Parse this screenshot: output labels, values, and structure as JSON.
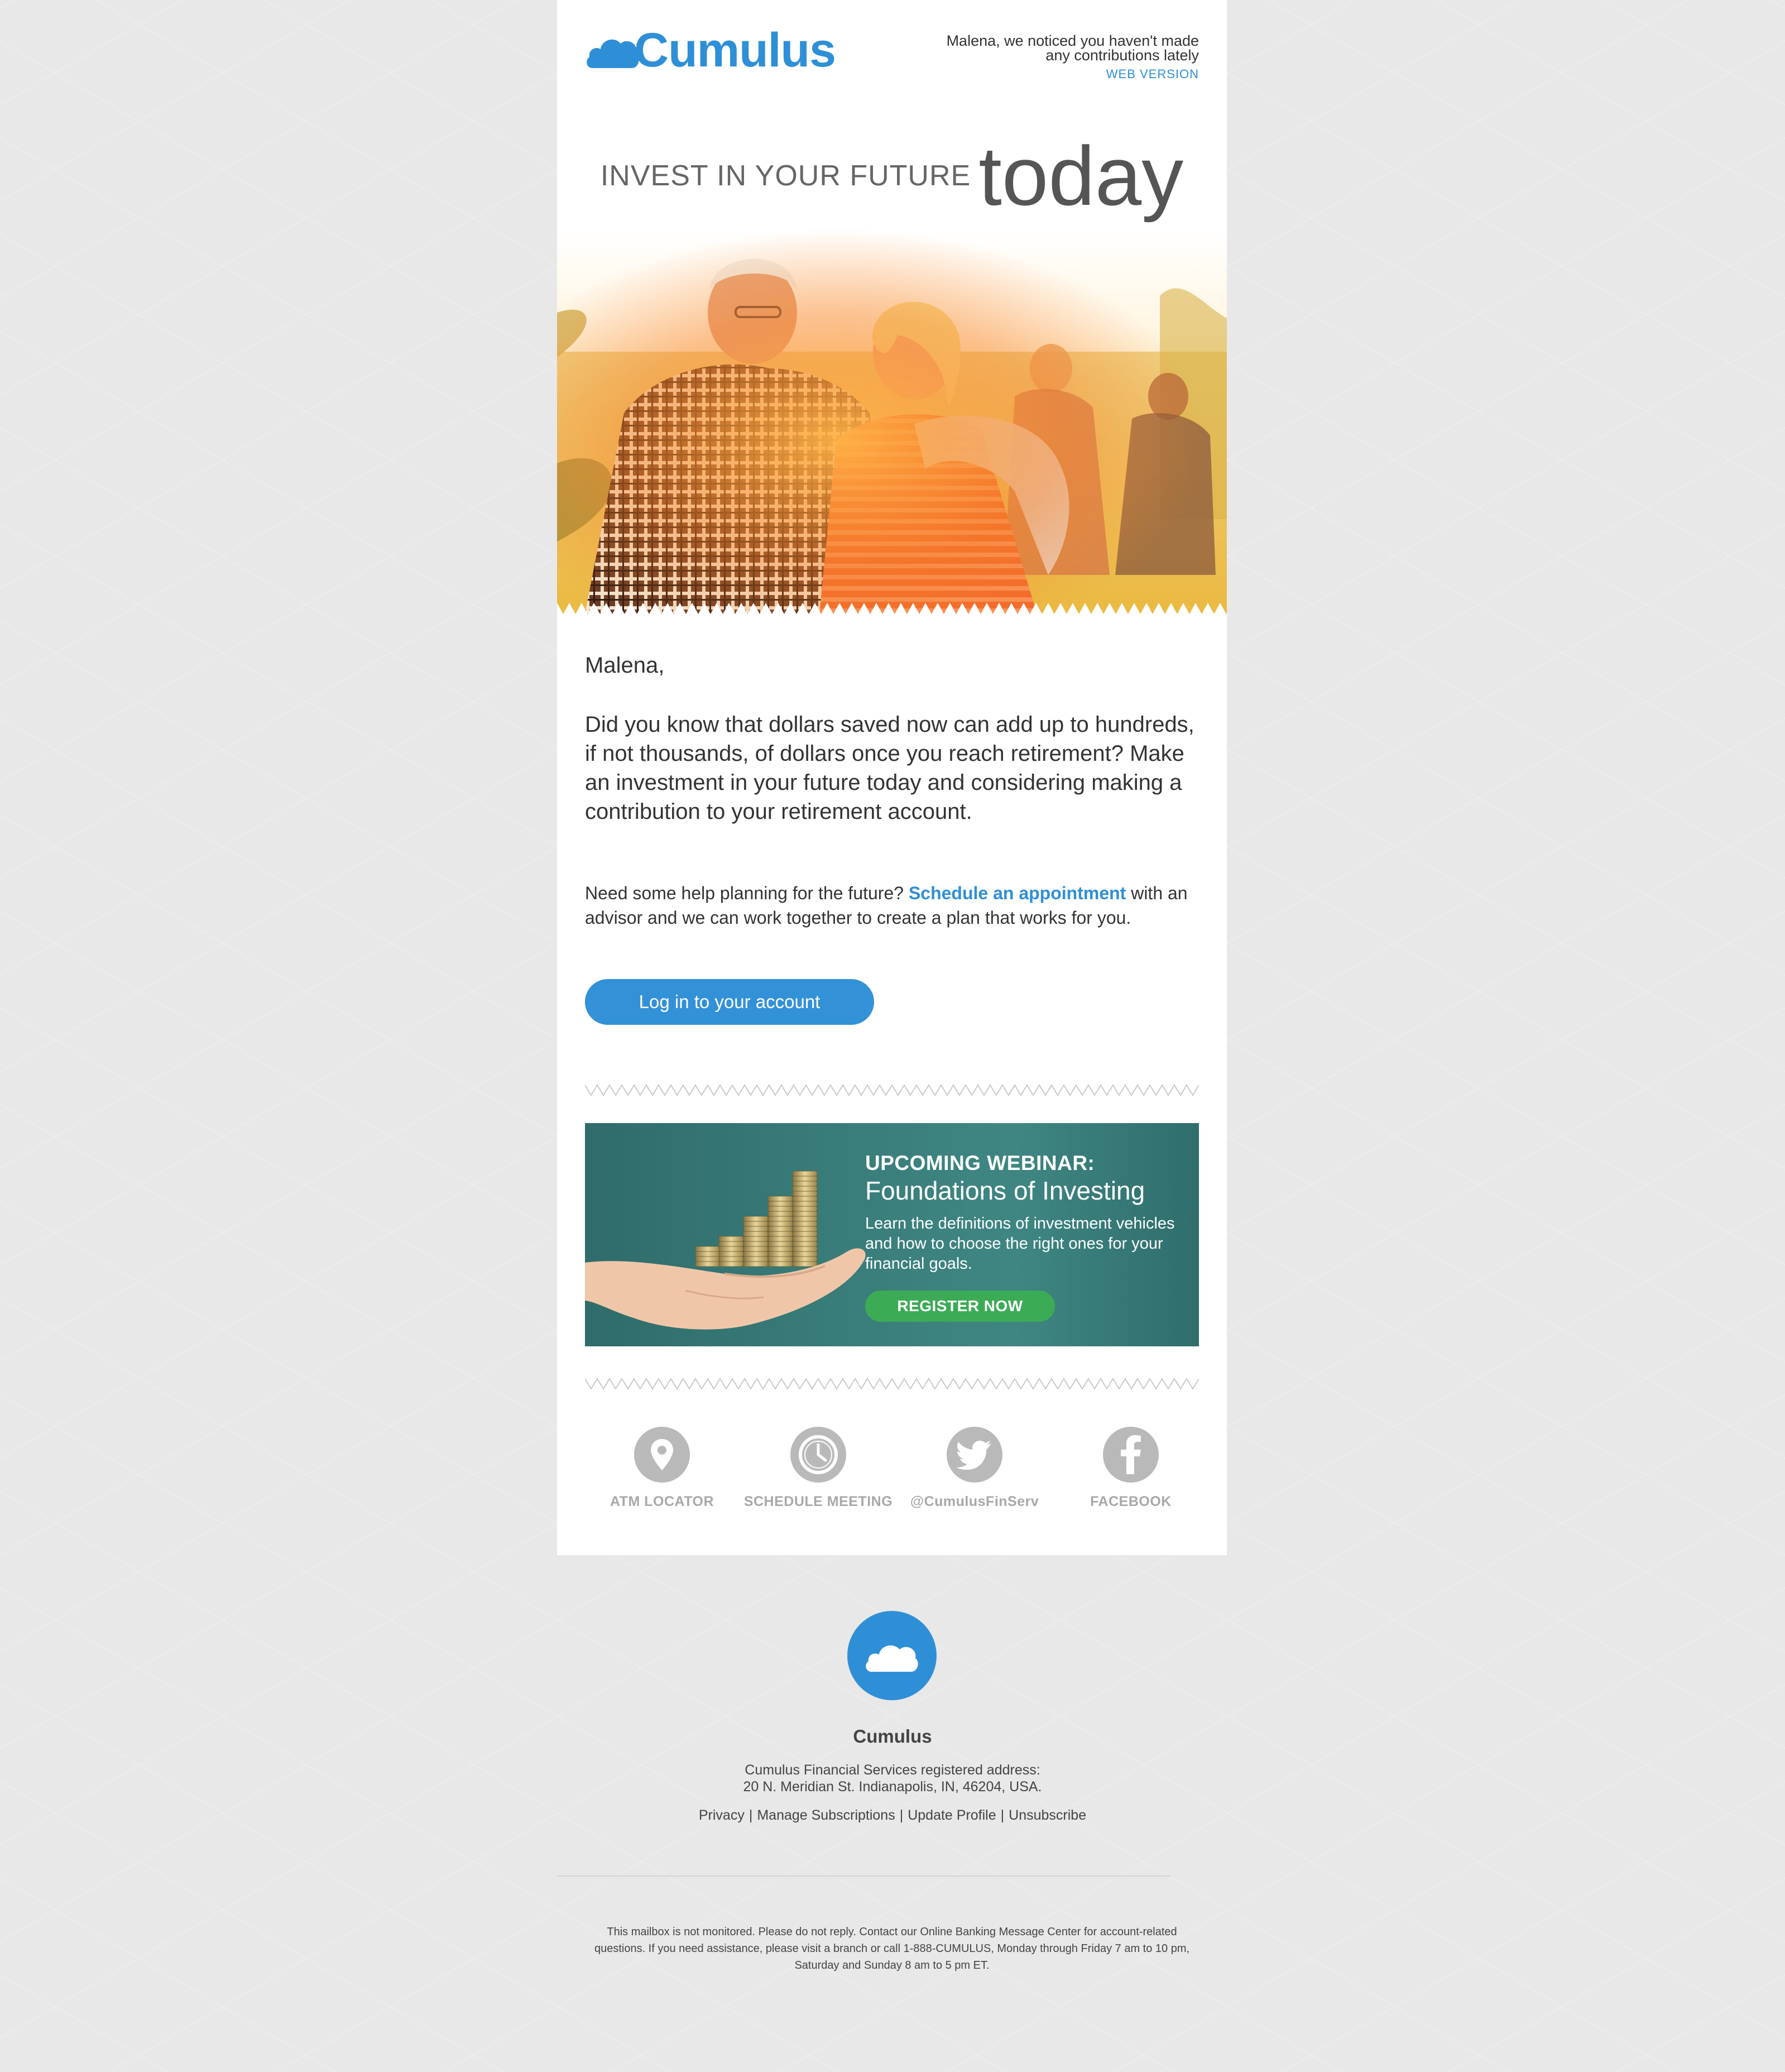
{
  "header": {
    "brand_name": "Cumulus",
    "preheader_text": "Malena, we noticed you haven't made any contributions lately",
    "web_version_label": "WEB VERSION"
  },
  "hero": {
    "headline_small": "INVEST IN YOUR FUTURE",
    "headline_big": "today"
  },
  "body": {
    "salutation": "Malena,",
    "intro": "Did you know that dollars saved now can add up to hundreds, if not thousands, of dollars once you reach retirement? Make an investment in your future today and considering making a contribution to your retirement account.",
    "help_prefix": "Need some help planning for the future?",
    "help_link": "Schedule an appointment",
    "help_suffix": "with an advisor and we can work together to create a plan that works for you.",
    "login_button": "Log in to your account"
  },
  "webinar": {
    "kicker": "UPCOMING WEBINAR:",
    "title": "Foundations of Investing",
    "description": "Learn the definitions of investment vehicles and how to choose the right ones for your financial goals.",
    "register_button": "REGISTER NOW"
  },
  "quicklinks": [
    {
      "label": "ATM LOCATOR",
      "icon": "location-pin-icon"
    },
    {
      "label": "SCHEDULE MEETING",
      "icon": "clock-icon"
    },
    {
      "label": "@CumulusFinServ",
      "icon": "twitter-icon"
    },
    {
      "label": "FACEBOOK",
      "icon": "facebook-icon"
    }
  ],
  "footer": {
    "brand_name": "Cumulus",
    "address_line1": "Cumulus Financial Services registered address:",
    "address_line2": "20 N. Meridian St. Indianapolis, IN, 46204, USA.",
    "links": [
      "Privacy",
      "Manage Subscriptions",
      "Update Profile",
      "Unsubscribe"
    ],
    "link_separator": "|",
    "disclaimer_line1": "This mailbox is not monitored. Please do not reply. Contact our Online Banking Message Center for account-related",
    "disclaimer_line2": "questions. If you need assistance, please visit a branch or call 1-888-CUMULUS, Monday through Friday 7 am to 10 pm,",
    "disclaimer_line3": "Saturday and Sunday 8 am to 5 pm ET."
  },
  "colors": {
    "brand_blue": "#2f8fd6",
    "button_blue": "#3391d8",
    "webinar_teal": "#3a7e7b",
    "register_green": "#3cab56",
    "icon_gray": "#b9b9b9",
    "page_background": "#e8e8e8"
  }
}
